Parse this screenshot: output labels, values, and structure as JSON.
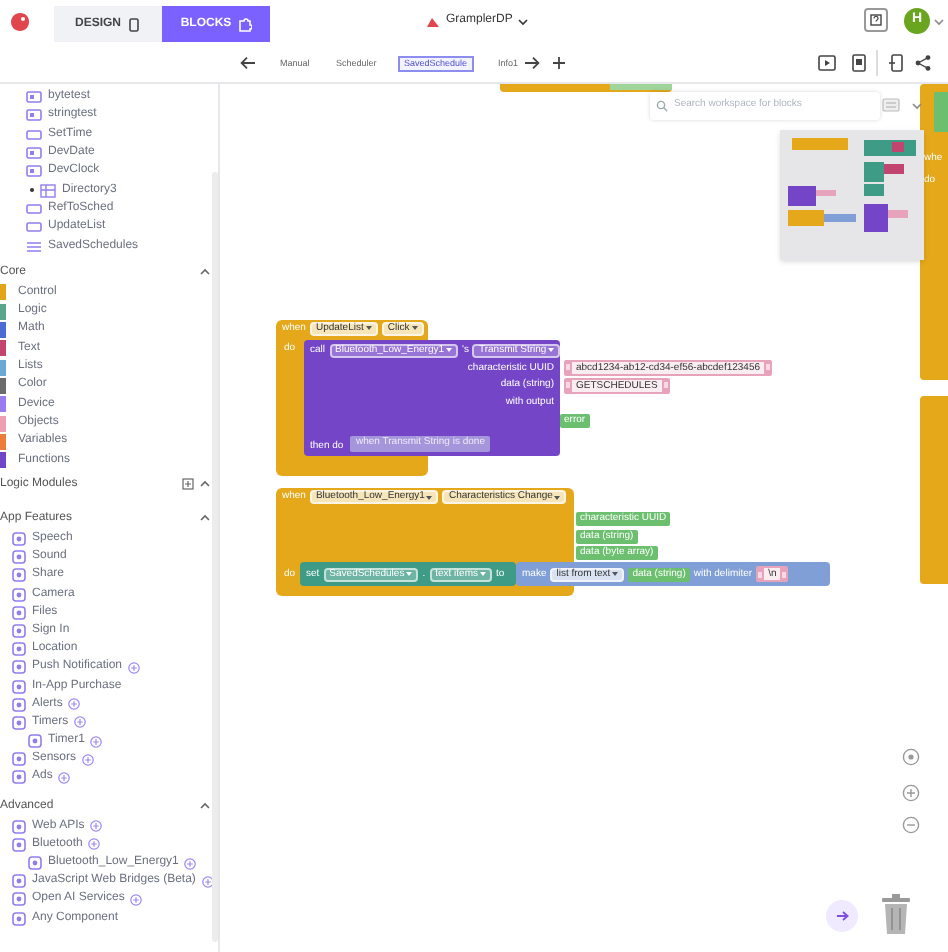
{
  "app_bar": {
    "tabs": [
      {
        "label": "DESIGN",
        "kind": "design",
        "selected": false
      },
      {
        "label": "BLOCKS",
        "kind": "blocks",
        "selected": true
      }
    ],
    "project": "GramplerDP",
    "avatar": "H"
  },
  "screen_bar": {
    "screens": [
      {
        "label": "Manual",
        "selected": false
      },
      {
        "label": "Scheduler",
        "selected": false
      },
      {
        "label": "SavedSchedule",
        "selected": true
      },
      {
        "label": "Info1",
        "selected": false
      }
    ]
  },
  "components": [
    {
      "label": "bytetest",
      "kind": "button"
    },
    {
      "label": "stringtest",
      "kind": "button"
    },
    {
      "label": "SetTime",
      "kind": "label"
    },
    {
      "label": "DevDate",
      "kind": "button"
    },
    {
      "label": "DevClock",
      "kind": "button"
    },
    {
      "label": "Directory3",
      "kind": "folder"
    },
    {
      "label": "RefToSched",
      "kind": "label"
    },
    {
      "label": "UpdateList",
      "kind": "label"
    },
    {
      "label": "SavedSchedules",
      "kind": "listview"
    }
  ],
  "core": {
    "title": "Core",
    "items": [
      {
        "label": "Control",
        "color": "#e2a517"
      },
      {
        "label": "Logic",
        "color": "#5ba58c"
      },
      {
        "label": "Math",
        "color": "#4a6cd4"
      },
      {
        "label": "Text",
        "color": "#c2456f"
      },
      {
        "label": "Lists",
        "color": "#6aaad6"
      },
      {
        "label": "Color",
        "color": "#6b6b6b"
      },
      {
        "label": "Device",
        "color": "#9a7bf0"
      },
      {
        "label": "Objects",
        "color": "#ef9fb3"
      },
      {
        "label": "Variables",
        "color": "#ee7d3b"
      },
      {
        "label": "Functions",
        "color": "#7046c8"
      }
    ]
  },
  "logic_modules": {
    "title": "Logic Modules"
  },
  "app_features": {
    "title": "App Features",
    "items": [
      {
        "label": "Speech",
        "addable": false
      },
      {
        "label": "Sound",
        "addable": false
      },
      {
        "label": "Share",
        "addable": false
      },
      {
        "label": "Camera",
        "addable": false
      },
      {
        "label": "Files",
        "addable": false
      },
      {
        "label": "Sign In",
        "addable": false
      },
      {
        "label": "Location",
        "addable": false
      },
      {
        "label": "Push Notification",
        "addable": true
      },
      {
        "label": "In-App Purchase",
        "addable": false
      },
      {
        "label": "Alerts",
        "addable": true
      },
      {
        "label": "Timers",
        "addable": true,
        "children": [
          {
            "label": "Timer1",
            "addable": true
          }
        ]
      },
      {
        "label": "Sensors",
        "addable": true
      },
      {
        "label": "Ads",
        "addable": true
      }
    ]
  },
  "advanced": {
    "title": "Advanced",
    "items": [
      {
        "label": "Web APIs",
        "addable": true
      },
      {
        "label": "Bluetooth",
        "addable": true,
        "children": [
          {
            "label": "Bluetooth_Low_Energy1",
            "addable": true
          }
        ]
      },
      {
        "label": "JavaScript Web Bridges (Beta)",
        "addable": true
      },
      {
        "label": "Open AI Services",
        "addable": true
      },
      {
        "label": "Any Component",
        "addable": false
      }
    ]
  },
  "workspace": {
    "search_placeholder": "Search workspace for blocks",
    "update_list_event": {
      "when": "when",
      "component": "UpdateList",
      "event": "Click",
      "do": "do",
      "call": "call",
      "target": "Bluetooth_Low_Energy1",
      "possessive": "'s",
      "method": "Transmit String",
      "args": [
        {
          "label": "characteristic UUID",
          "value": "abcd1234-ab12-cd34-ef56-abcdef123456"
        },
        {
          "label": "data (string)",
          "value": "GETSCHEDULES"
        },
        {
          "label": "with output"
        }
      ],
      "output": "error",
      "then_do": "then do",
      "callback": "when Transmit String is done"
    },
    "characteristics_event": {
      "when": "when",
      "component": "Bluetooth_Low_Energy1",
      "event": "Characteristics Change",
      "params": [
        "characteristic UUID",
        "data (string)",
        "data (byte array)"
      ],
      "do": "do",
      "set": "set",
      "variable": "SavedSchedules",
      "dot": ".",
      "property": "text items",
      "to": "to",
      "make": "make",
      "make_kind": "list from text",
      "arg": "data (string)",
      "with_delimiter": "with delimiter",
      "delimiter": "\\n"
    },
    "edge_block": {
      "when": "whe",
      "do": "do"
    }
  }
}
